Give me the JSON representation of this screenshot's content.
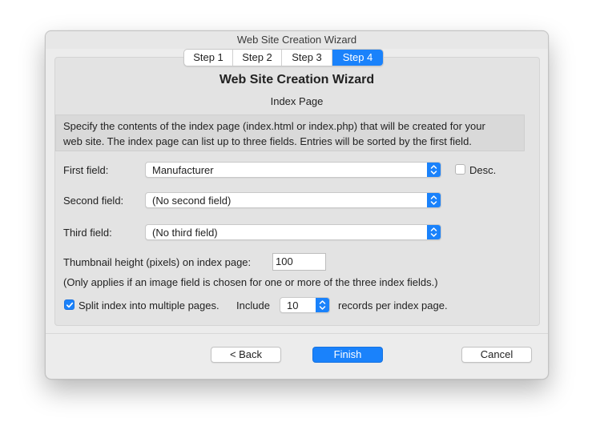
{
  "window": {
    "title": "Web Site Creation Wizard"
  },
  "tabs": [
    {
      "label": "Step 1",
      "active": false
    },
    {
      "label": "Step 2",
      "active": false
    },
    {
      "label": "Step 3",
      "active": false
    },
    {
      "label": "Step 4",
      "active": true
    }
  ],
  "heading": {
    "title": "Web Site Creation Wizard",
    "subtitle": "Index Page"
  },
  "description": {
    "line1": "Specify the contents of the index page (index.html or index.php) that will be created for your",
    "line2": "web site. The index page can list up to three fields.  Entries will be sorted by the first field."
  },
  "fields": {
    "first": {
      "label": "First field:",
      "value": "Manufacturer"
    },
    "second": {
      "label": "Second field:",
      "value": "(No second field)"
    },
    "third": {
      "label": "Third field:",
      "value": "(No third field)"
    },
    "desc": {
      "label": "Desc.",
      "checked": false
    }
  },
  "thumbnail": {
    "label": "Thumbnail height (pixels) on index page:",
    "value": "100",
    "note": "(Only applies if an image field is chosen for one or more of the three index fields.)"
  },
  "split": {
    "checked": true,
    "label": "Split index into multiple pages.",
    "include_label": "Include",
    "count": "10",
    "suffix": "records per index page."
  },
  "buttons": {
    "back": "< Back",
    "finish": "Finish",
    "cancel": "Cancel"
  },
  "colors": {
    "accent": "#1a82fb",
    "window_bg": "#ececec",
    "panel_bg": "#e3e3e3"
  }
}
